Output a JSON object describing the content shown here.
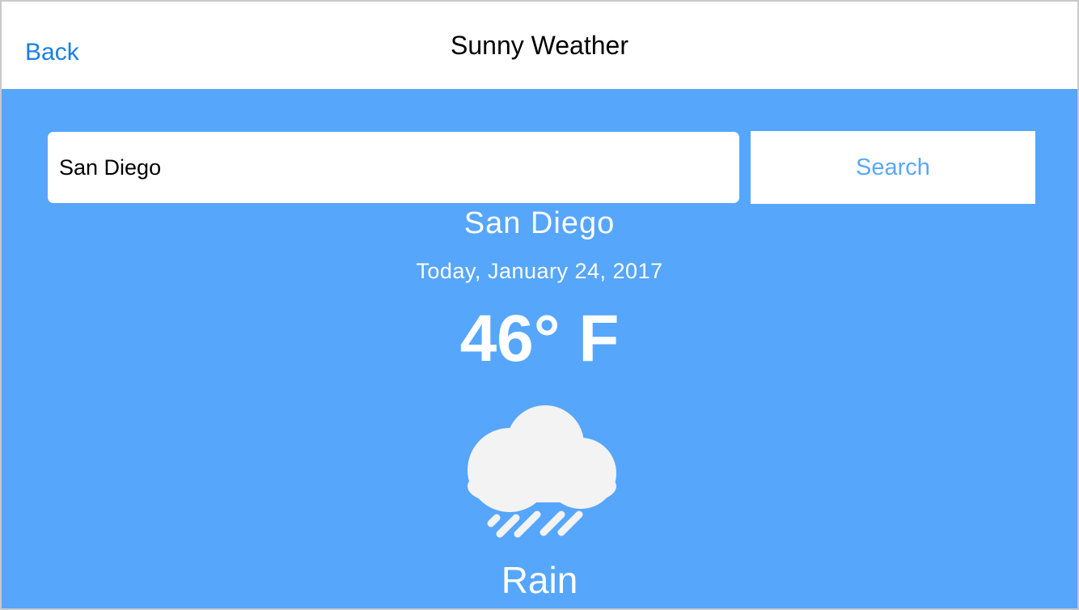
{
  "nav": {
    "back_label": "Back",
    "title": "Sunny Weather"
  },
  "search": {
    "value": "San Diego",
    "button_label": "Search"
  },
  "weather": {
    "city": "San Diego",
    "date": "Today, January 24, 2017",
    "temperature": "46° F",
    "condition": "Rain",
    "icon": "rain-cloud-icon"
  },
  "colors": {
    "background": "#56a6fc",
    "accent": "#1a7ee6",
    "search_button_text": "#5aa8fa",
    "text_on_background": "#ffffff",
    "icon_fill": "#f3f3f3"
  }
}
